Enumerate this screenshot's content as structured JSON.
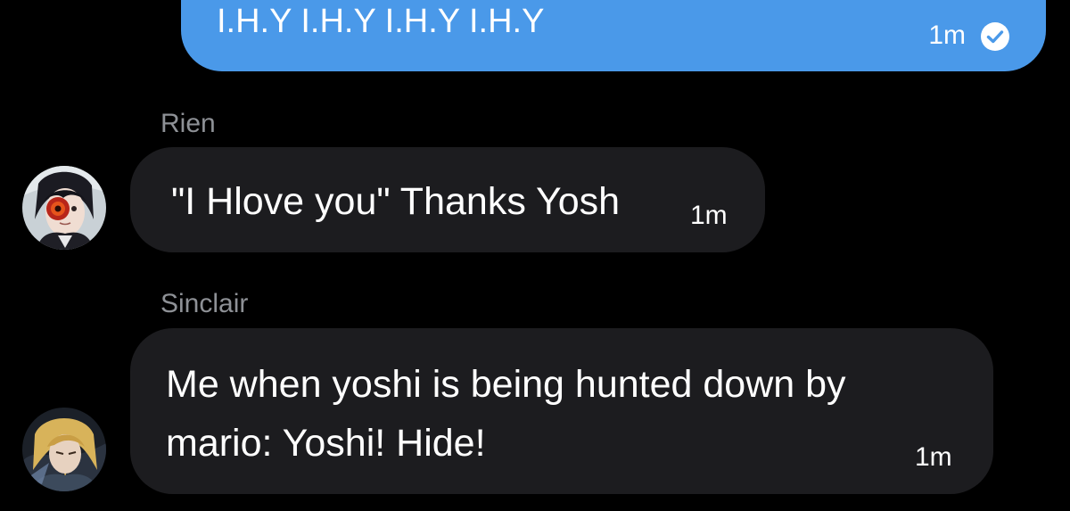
{
  "colors": {
    "background": "#000000",
    "outgoing_bubble": "#4a99e9",
    "incoming_bubble": "#1c1c1f",
    "sender_name": "#8e9196",
    "text": "#ffffff"
  },
  "messages": [
    {
      "direction": "outgoing",
      "text": "I.H.Y I.H.Y I.H.Y I.H.Y",
      "time": "1m",
      "status_icon": "read-check-icon"
    },
    {
      "direction": "incoming",
      "sender": "Rien",
      "avatar_icon": "avatar-rien",
      "text": "\"I Hlove you\" Thanks Yosh",
      "time": "1m"
    },
    {
      "direction": "incoming",
      "sender": "Sinclair",
      "avatar_icon": "avatar-sinclair",
      "text_lines": [
        "Me when yoshi is being hunted down by",
        "mario: Yoshi! Hide!"
      ],
      "time": "1m"
    }
  ]
}
